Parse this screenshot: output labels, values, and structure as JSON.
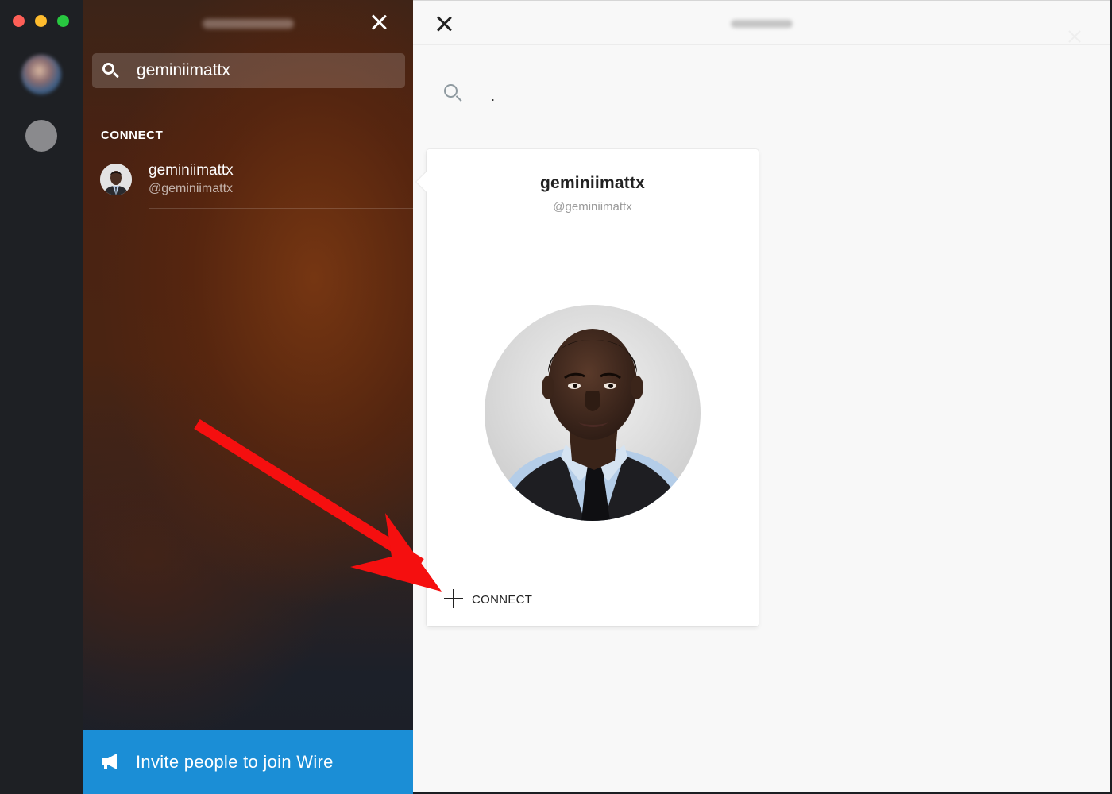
{
  "window": {
    "controls": {
      "close_color": "#fe5f57",
      "minimize_color": "#febc2e",
      "maximize_color": "#28c840"
    }
  },
  "sidebar": {
    "search": {
      "value": "geminiimattx"
    },
    "section_header": "CONNECT",
    "results": [
      {
        "name": "geminiimattx",
        "handle": "@geminiimattx"
      }
    ],
    "invite_label": "Invite people to join Wire"
  },
  "main": {
    "search_value": ".",
    "card": {
      "name": "geminiimattx",
      "handle": "@geminiimattx",
      "connect_label": "CONNECT"
    }
  },
  "colors": {
    "invite_blue": "#1b8ed6",
    "annotation_arrow": "#f50f0f"
  },
  "icons": [
    "search-icon",
    "close-icon",
    "megaphone-icon",
    "plus-icon"
  ]
}
